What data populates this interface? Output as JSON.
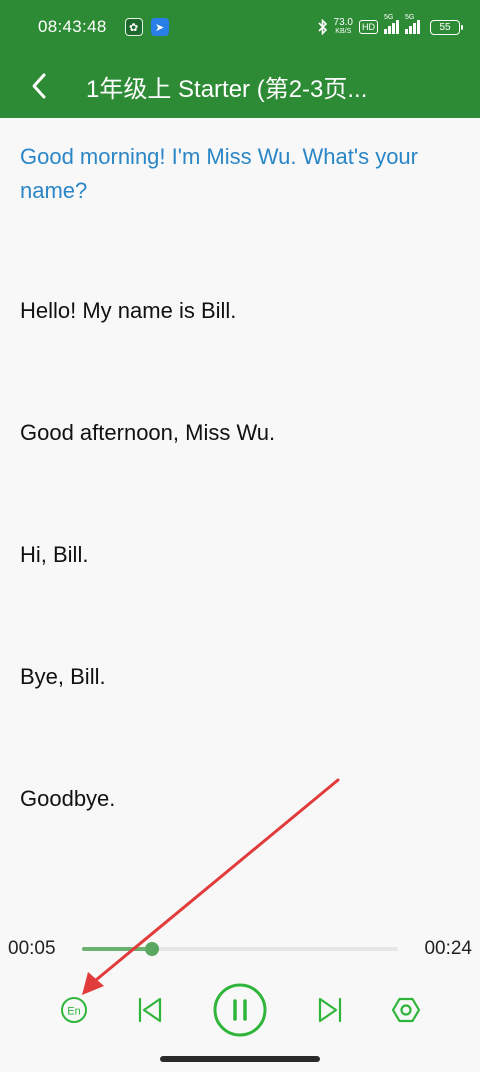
{
  "status_bar": {
    "time": "08:43:48",
    "net_speed": "73.0",
    "net_unit": "KB/S",
    "hd_label": "HD",
    "sim1_label": "5G",
    "sim2_label": "5G",
    "battery": "55",
    "app_icon_a": "app-a-icon",
    "app_icon_b": "app-b-icon"
  },
  "header": {
    "title": "1年级上 Starter (第2-3页...",
    "back_icon": "chevron-left-icon",
    "background_color": "#2e8b35"
  },
  "lines": [
    {
      "text": "Good morning! I'm Miss Wu. What's your name?",
      "active": true
    },
    {
      "text": "Hello! My name is Bill.",
      "active": false
    },
    {
      "text": "Good afternoon, Miss Wu.",
      "active": false
    },
    {
      "text": "Hi, Bill.",
      "active": false
    },
    {
      "text": "Bye, Bill.",
      "active": false
    },
    {
      "text": "Goodbye.",
      "active": false
    }
  ],
  "player": {
    "current_time": "00:05",
    "total_time": "00:24",
    "progress_fraction": 0.22,
    "accent_color": "#2fb53a",
    "buttons": {
      "language_label": "En",
      "language_icon": "en-language-icon",
      "prev_icon": "skip-previous-icon",
      "pause_icon": "pause-icon",
      "next_icon": "skip-next-icon",
      "settings_icon": "hexagon-settings-icon"
    }
  },
  "annotation": {
    "arrow_color": "#e23b3b",
    "arrow_target": "language-button"
  }
}
